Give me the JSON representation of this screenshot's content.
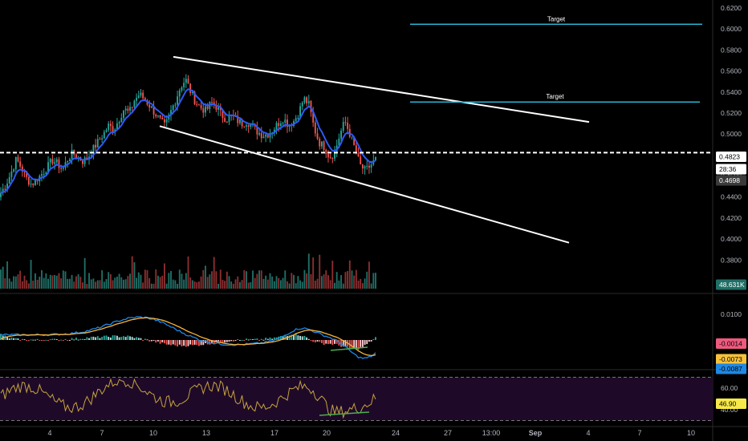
{
  "chart_data": [
    {
      "type": "candlestick",
      "title": "",
      "ylim": [
        0.376,
        0.631
      ],
      "y_ticks": [
        {
          "v": 0.62,
          "label": "0.6200"
        },
        {
          "v": 0.6,
          "label": "0.6000"
        },
        {
          "v": 0.58,
          "label": "0.5800"
        },
        {
          "v": 0.56,
          "label": "0.5600"
        },
        {
          "v": 0.54,
          "label": "0.5400"
        },
        {
          "v": 0.52,
          "label": "0.5200"
        },
        {
          "v": 0.5,
          "label": "0.5000"
        },
        {
          "v": 0.46,
          "label": "0.4600"
        },
        {
          "v": 0.44,
          "label": "0.4400"
        },
        {
          "v": 0.42,
          "label": "0.4200"
        },
        {
          "v": 0.4,
          "label": "0.4000"
        },
        {
          "v": 0.38,
          "label": "0.3800"
        }
      ],
      "x_ticks": [
        "4",
        "7",
        "10",
        "13",
        "17",
        "20",
        "24",
        "27",
        "13:00",
        "Sep",
        "4",
        "7",
        "10"
      ],
      "price_path": [
        0.444,
        0.452,
        0.463,
        0.476,
        0.468,
        0.458,
        0.452,
        0.457,
        0.462,
        0.468,
        0.475,
        0.472,
        0.466,
        0.476,
        0.482,
        0.478,
        0.474,
        0.478,
        0.486,
        0.493,
        0.5,
        0.508,
        0.504,
        0.514,
        0.524,
        0.52,
        0.532,
        0.538,
        0.533,
        0.527,
        0.52,
        0.513,
        0.507,
        0.52,
        0.532,
        0.545,
        0.552,
        0.54,
        0.53,
        0.525,
        0.522,
        0.53,
        0.526,
        0.518,
        0.514,
        0.517,
        0.513,
        0.51,
        0.512,
        0.507,
        0.502,
        0.499,
        0.5,
        0.504,
        0.51,
        0.515,
        0.509,
        0.512,
        0.52,
        0.534,
        0.528,
        0.506,
        0.492,
        0.488,
        0.478,
        0.482,
        0.499,
        0.512,
        0.5,
        0.485,
        0.47,
        0.465,
        0.47,
        0.476
      ],
      "moving_average_color": "#2d59f5",
      "current_price": {
        "value": 0.4823,
        "label": "0.4823",
        "timer": "28:36"
      },
      "secondary_price": {
        "value": 0.4698,
        "label": "0.4698"
      },
      "volume_label": "48.631K",
      "annotations": [
        {
          "type": "target",
          "label": "Target",
          "y": 0.6045,
          "color": "#29b6d6"
        },
        {
          "type": "target",
          "label": "Target",
          "y": 0.5305,
          "color": "#29b6d6"
        }
      ],
      "trendlines": [
        {
          "name": "upper",
          "from_price": 0.5735,
          "to_price": 0.5115,
          "color": "#ffffff"
        },
        {
          "name": "lower",
          "from_price": 0.5075,
          "to_price": 0.3965,
          "color": "#ffffff"
        }
      ]
    },
    {
      "type": "macd",
      "ylim": [
        -0.0105,
        0.0135
      ],
      "y_ticks": [
        {
          "v": 0.01,
          "label": "0.0100"
        }
      ],
      "value_labels": [
        {
          "label": "-0.0014",
          "bg": "#ee5a7e",
          "fg": "#000000"
        },
        {
          "label": "-0.0073",
          "bg": "#f7c23c",
          "fg": "#000000"
        },
        {
          "label": "-0.0087",
          "bg": "#1e88e5",
          "fg": "#000000"
        }
      ],
      "colors": {
        "macd": "#1e88e5",
        "signal": "#f7b23c",
        "hist_pos": "#26a69a",
        "hist_pos_weak": "#b2dfdb",
        "hist_neg": "#ef5350",
        "hist_neg_weak": "#ffcdd2"
      }
    },
    {
      "type": "rsi",
      "ylim": [
        30,
        70
      ],
      "y_ticks": [
        {
          "v": 60,
          "label": "60.00"
        },
        {
          "v": 40,
          "label": "40.00"
        }
      ],
      "value_label": {
        "label": "46.90",
        "bg": "#f7e94a",
        "fg": "#000000"
      },
      "band": [
        30,
        70
      ],
      "colors": {
        "line": "#c6a23f",
        "band": "#1e0a28",
        "divergence": "#4caf50"
      }
    }
  ]
}
